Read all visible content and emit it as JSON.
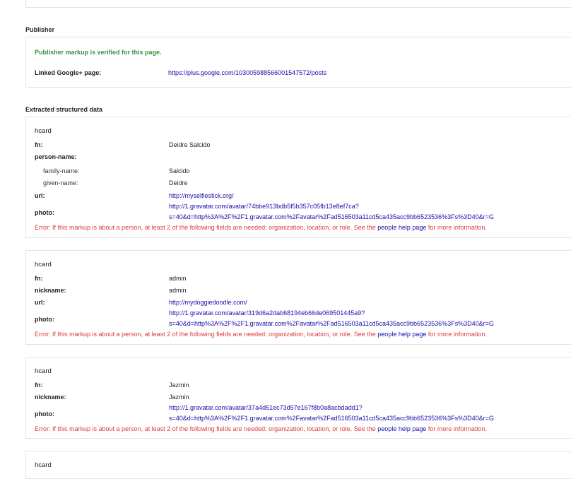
{
  "publisher": {
    "heading": "Publisher",
    "verified": "Publisher markup is verified for this page.",
    "linked_label": "Linked Google+ page:",
    "linked_url": "https://plus.google.com/103005988566001547572/posts"
  },
  "extracted": {
    "heading": "Extracted structured data",
    "cards": [
      {
        "title": "hcard",
        "fn_label": "fn:",
        "fn": "Deidre Salcido",
        "person_name_label": "person-name:",
        "family_name_label": "family-name:",
        "family_name": "Salcido",
        "given_name_label": "given-name:",
        "given_name": "Deidre",
        "url_label": "url:",
        "url": "http://myselfiestick.org/",
        "photo_label": "photo:",
        "photo_line1": "http://1.gravatar.com/avatar/74bbe913bdb5f5b357c05fb13e8ef7ca?",
        "photo_line2": "s=40&d=http%3A%2F%2F1.gravatar.com%2Favatar%2Fad516503a11cd5ca435acc9bb6523536%3Fs%3D40&r=G",
        "error_prefix": "Error: If this markup is about a person, at least 2 of the following fields are needed: organization, location, or role. See the",
        "error_link": "people help page",
        "error_suffix": "for more information."
      },
      {
        "title": "hcard",
        "fn_label": "fn:",
        "fn": "admin",
        "nickname_label": "nickname:",
        "nickname": "admin",
        "url_label": "url:",
        "url": "http://mydoggiedoodle.com/",
        "photo_label": "photo:",
        "photo_line1": "http://1.gravatar.com/avatar/319d6a2dab68194eb66de069501445a9?",
        "photo_line2": "s=40&d=http%3A%2F%2F1.gravatar.com%2Favatar%2Fad516503a11cd5ca435acc9bb6523536%3Fs%3D40&r=G",
        "error_prefix": "Error: If this markup is about a person, at least 2 of the following fields are needed: organization, location, or role. See the",
        "error_link": "people help page",
        "error_suffix": "for more information."
      },
      {
        "title": "hcard",
        "fn_label": "fn:",
        "fn": "Jazmin",
        "nickname_label": "nickname:",
        "nickname": "Jazmin",
        "photo_label": "photo:",
        "photo_line1": "http://1.gravatar.com/avatar/37a4d51ec73d57e167f8b0a8acbdadd1?",
        "photo_line2": "s=40&d=http%3A%2F%2F1.gravatar.com%2Favatar%2Fad516503a11cd5ca435acc9bb6523536%3Fs%3D40&r=G",
        "error_prefix": "Error: If this markup is about a person, at least 2 of the following fields are needed: organization, location, or role. See the",
        "error_link": "people help page",
        "error_suffix": "for more information."
      },
      {
        "title": "hcard"
      }
    ]
  }
}
